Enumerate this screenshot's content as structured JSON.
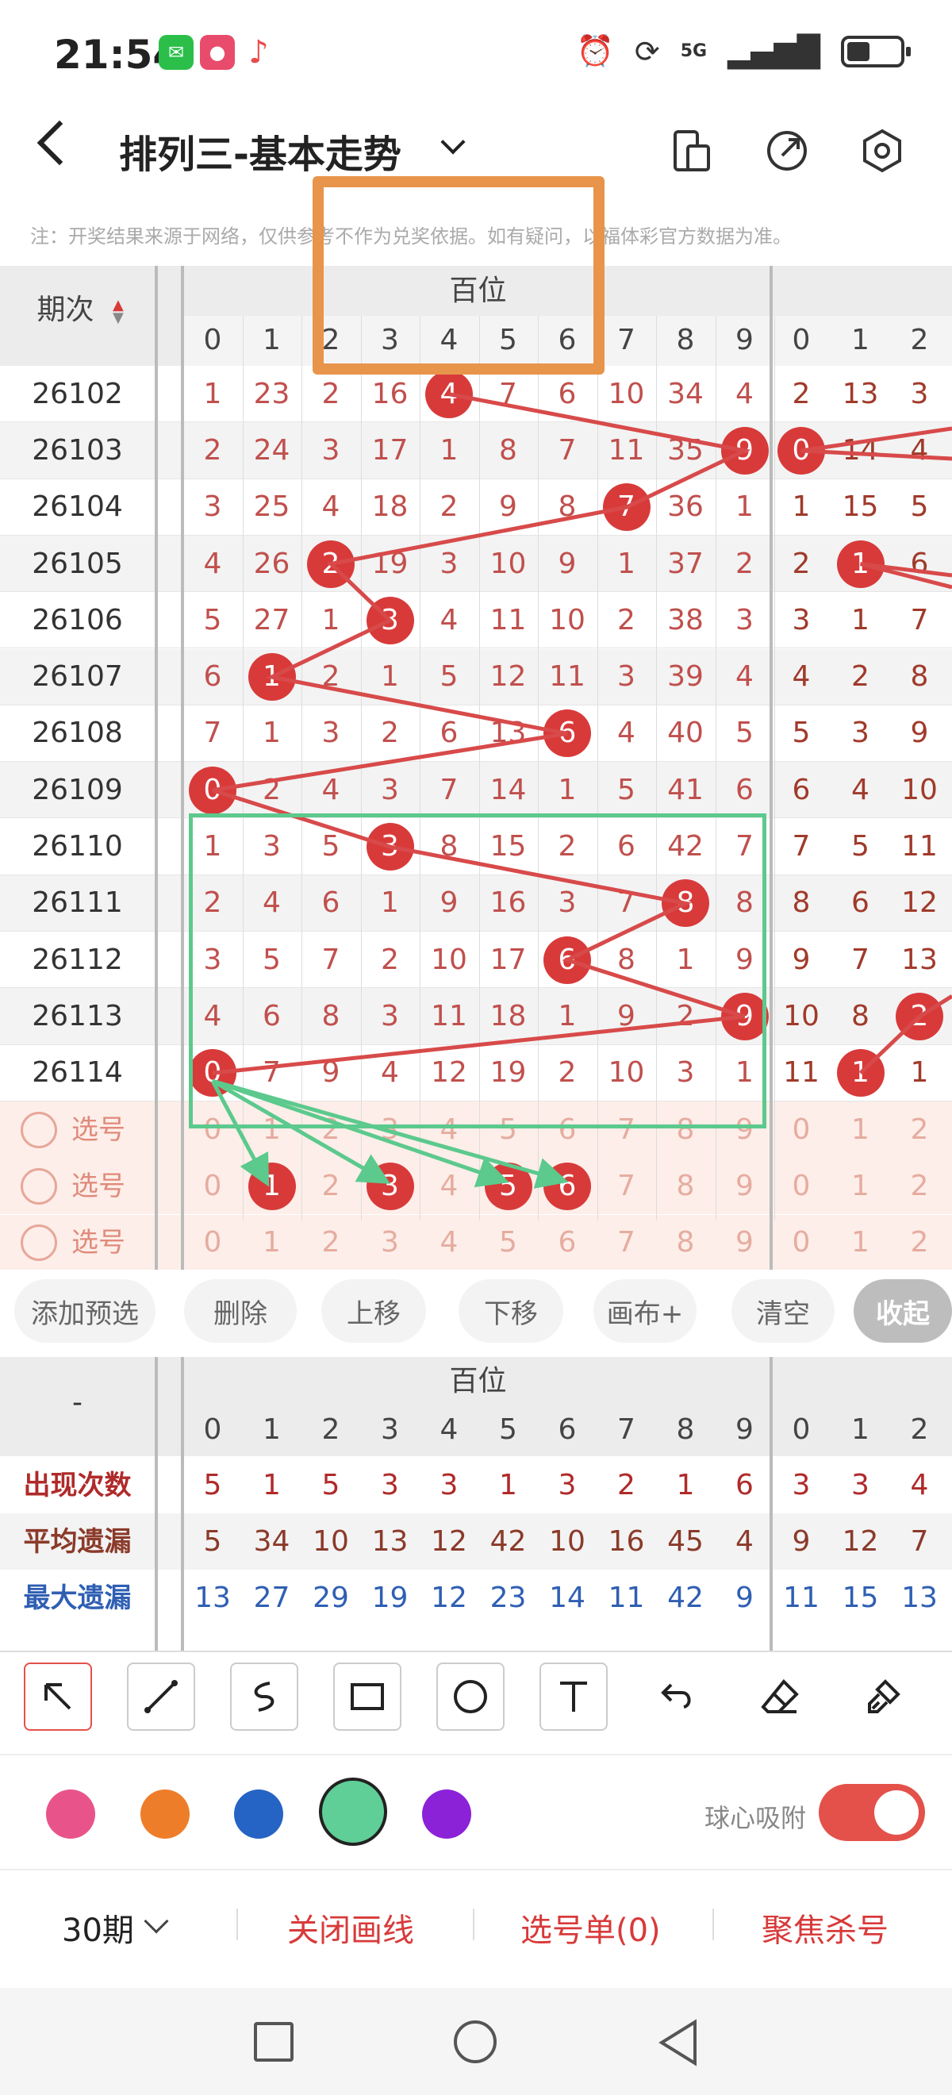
{
  "status": {
    "time": "21:54",
    "signal": "5G"
  },
  "header": {
    "title": "排列三-基本走势"
  },
  "notice": "注：开奖结果来源于网络，仅供参考不作为兑奖依据。如有疑问，以福体彩官方数据为准。",
  "grid": {
    "period_header": "期次",
    "section_label": "百位",
    "digits": [
      "0",
      "1",
      "2",
      "3",
      "4",
      "5",
      "6",
      "7",
      "8",
      "9"
    ],
    "next_digits": [
      "0",
      "1",
      "2"
    ],
    "rows": [
      {
        "period": "26102",
        "cells": [
          "1",
          "23",
          "2",
          "16",
          "4",
          "7",
          "6",
          "10",
          "34",
          "4"
        ],
        "hit": 4,
        "next": [
          "2",
          "13",
          "3"
        ],
        "next_hit": -1
      },
      {
        "period": "26103",
        "cells": [
          "2",
          "24",
          "3",
          "17",
          "1",
          "8",
          "7",
          "11",
          "35",
          "9"
        ],
        "hit": 9,
        "next": [
          "0",
          "14",
          "4"
        ],
        "next_hit": 0
      },
      {
        "period": "26104",
        "cells": [
          "3",
          "25",
          "4",
          "18",
          "2",
          "9",
          "8",
          "7",
          "36",
          "1"
        ],
        "hit": 7,
        "next": [
          "1",
          "15",
          "5"
        ],
        "next_hit": -1
      },
      {
        "period": "26105",
        "cells": [
          "4",
          "26",
          "2",
          "19",
          "3",
          "10",
          "9",
          "1",
          "37",
          "2"
        ],
        "hit": 2,
        "next": [
          "2",
          "1",
          "6"
        ],
        "next_hit": 1
      },
      {
        "period": "26106",
        "cells": [
          "5",
          "27",
          "1",
          "3",
          "4",
          "11",
          "10",
          "2",
          "38",
          "3"
        ],
        "hit": 3,
        "next": [
          "3",
          "1",
          "7"
        ],
        "next_hit": -1
      },
      {
        "period": "26107",
        "cells": [
          "6",
          "1",
          "2",
          "1",
          "5",
          "12",
          "11",
          "3",
          "39",
          "4"
        ],
        "hit": 1,
        "next": [
          "4",
          "2",
          "8"
        ],
        "next_hit": -1
      },
      {
        "period": "26108",
        "cells": [
          "7",
          "1",
          "3",
          "2",
          "6",
          "13",
          "6",
          "4",
          "40",
          "5"
        ],
        "hit": 6,
        "next": [
          "5",
          "3",
          "9"
        ],
        "next_hit": -1
      },
      {
        "period": "26109",
        "cells": [
          "0",
          "2",
          "4",
          "3",
          "7",
          "14",
          "1",
          "5",
          "41",
          "6"
        ],
        "hit": 0,
        "next": [
          "6",
          "4",
          "10"
        ],
        "next_hit": -1
      },
      {
        "period": "26110",
        "cells": [
          "1",
          "3",
          "5",
          "3",
          "8",
          "15",
          "2",
          "6",
          "42",
          "7"
        ],
        "hit": 3,
        "next": [
          "7",
          "5",
          "11"
        ],
        "next_hit": -1
      },
      {
        "period": "26111",
        "cells": [
          "2",
          "4",
          "6",
          "1",
          "9",
          "16",
          "3",
          "7",
          "8",
          "8"
        ],
        "hit": 8,
        "next": [
          "8",
          "6",
          "12"
        ],
        "next_hit": -1
      },
      {
        "period": "26112",
        "cells": [
          "3",
          "5",
          "7",
          "2",
          "10",
          "17",
          "6",
          "8",
          "1",
          "9"
        ],
        "hit": 6,
        "next": [
          "9",
          "7",
          "13"
        ],
        "next_hit": -1
      },
      {
        "period": "26113",
        "cells": [
          "4",
          "6",
          "8",
          "3",
          "11",
          "18",
          "1",
          "9",
          "2",
          "9"
        ],
        "hit": 9,
        "next": [
          "10",
          "8",
          "2"
        ],
        "next_hit": 2
      },
      {
        "period": "26114",
        "cells": [
          "0",
          "7",
          "9",
          "4",
          "12",
          "19",
          "2",
          "10",
          "3",
          "1"
        ],
        "hit": 0,
        "next": [
          "11",
          "1",
          "1"
        ],
        "next_hit": 1
      }
    ],
    "select_rows": [
      {
        "label": "选号",
        "picked": []
      },
      {
        "label": "选号",
        "picked": [
          1,
          3,
          5,
          6
        ]
      },
      {
        "label": "选号",
        "picked": []
      }
    ]
  },
  "actions": [
    "添加预选",
    "删除",
    "上移",
    "下移",
    "画布+",
    "清空",
    "收起"
  ],
  "stats": {
    "corner": "-",
    "section_label": "百位",
    "rows": [
      {
        "label": "出现次数",
        "values": [
          "5",
          "1",
          "5",
          "3",
          "3",
          "1",
          "3",
          "2",
          "1",
          "6"
        ],
        "next": [
          "3",
          "3",
          "4"
        ],
        "color": "#b02a2a"
      },
      {
        "label": "平均遗漏",
        "values": [
          "5",
          "34",
          "10",
          "13",
          "12",
          "42",
          "10",
          "16",
          "45",
          "4"
        ],
        "next": [
          "9",
          "12",
          "7"
        ],
        "color": "#8b3a2a"
      },
      {
        "label": "最大遗漏",
        "values": [
          "13",
          "27",
          "29",
          "19",
          "12",
          "23",
          "14",
          "11",
          "42",
          "9"
        ],
        "next": [
          "11",
          "15",
          "13"
        ],
        "color": "#2f5fb3"
      }
    ]
  },
  "tools": [
    "arrow-tool",
    "line-tool",
    "curve-tool",
    "rectangle-tool",
    "circle-tool",
    "text-tool",
    "undo",
    "eraser",
    "brush"
  ],
  "colors": [
    "#e8548a",
    "#ee7d2a",
    "#2563c4",
    "#5fcf97",
    "#8b22d8"
  ],
  "snap_label": "球心吸附",
  "bottom": {
    "periods": "30期",
    "close_draw": "关闭画线",
    "pick_list": "选号单(0)",
    "focus_kill": "聚焦杀号"
  }
}
